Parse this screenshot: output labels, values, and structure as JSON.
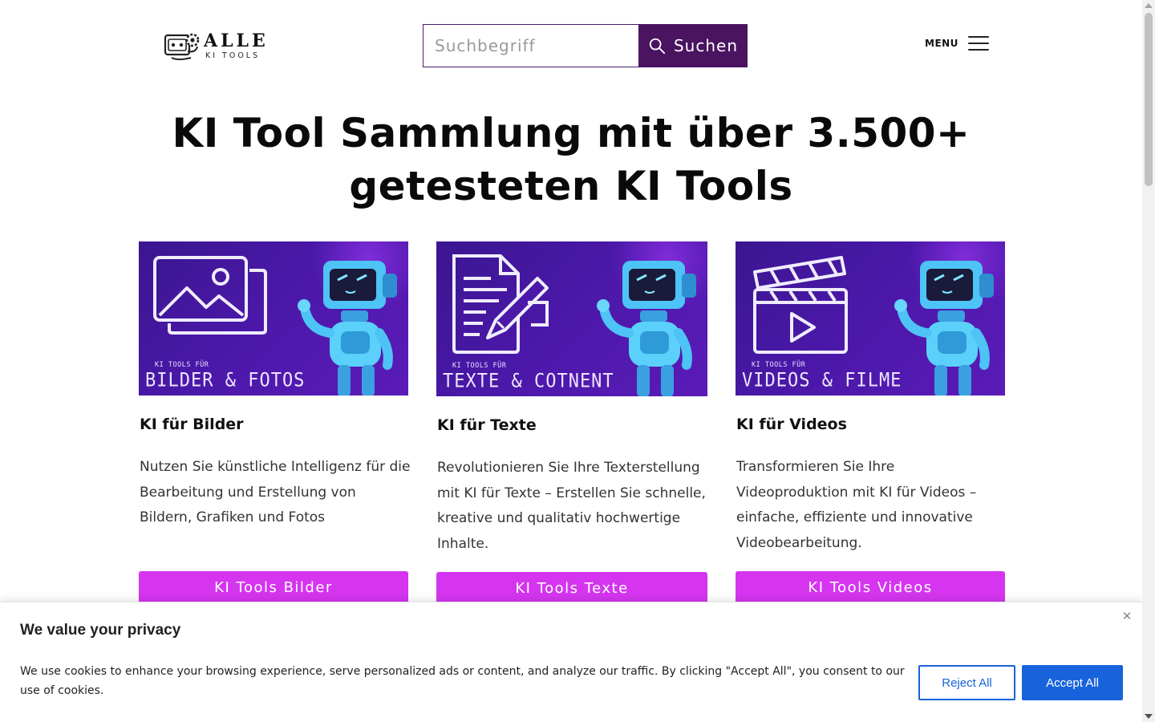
{
  "brand": {
    "title": "ALLE",
    "subtitle": "KI TOOLS",
    "icon": "robot-gear-logo-icon"
  },
  "search": {
    "placeholder": "Suchbegriff",
    "value": "",
    "button_label": "Suchen",
    "icon": "search-icon",
    "button_color": "#4a1461"
  },
  "menu": {
    "label": "MENU",
    "icon": "hamburger-icon"
  },
  "hero": {
    "line1": "KI Tool Sammlung mit über 3.500+",
    "line2": "getesteten KI Tools"
  },
  "cards": [
    {
      "image": {
        "small": "KI TOOLS FÜR",
        "big": "BILDER & FOTOS",
        "icon": "image-icon"
      },
      "title": "KI für Bilder",
      "description": "Nutzen Sie künstliche Intelligenz für die Bearbeitung und Erstellung von Bildern, Grafiken und Fotos",
      "button": "KI Tools Bilder"
    },
    {
      "image": {
        "small": "KI TOOLS FÜR",
        "big": "TEXTE & COTNENT",
        "icon": "document-pen-icon"
      },
      "title": "KI für Texte",
      "description": "Revolutionieren Sie Ihre Texterstellung mit KI für Texte – Erstellen Sie schnelle, kreative und qualitativ hochwertige Inhalte.",
      "button": "KI Tools Texte"
    },
    {
      "image": {
        "small": "KI TOOLS FÜR",
        "big": "VIDEOS & FILME",
        "icon": "clapperboard-icon"
      },
      "title": "KI für Videos",
      "description": "Transformieren Sie Ihre Videoproduktion mit KI für Videos – einfache, effiziente und innovative Videobearbeitung.",
      "button": "KI Tools Videos"
    }
  ],
  "cookie": {
    "title": "We value your privacy",
    "text": "We use cookies to enhance your browsing experience, serve personalized ads or content, and analyze our traffic. By clicking \"Accept All\", you consent to our use of cookies.",
    "reject": "Reject All",
    "accept": "Accept All",
    "close_icon": "close-icon",
    "accent": "#1863dc"
  },
  "colors": {
    "card_button": "#d535ef",
    "card_banner": "#4a18a8"
  }
}
